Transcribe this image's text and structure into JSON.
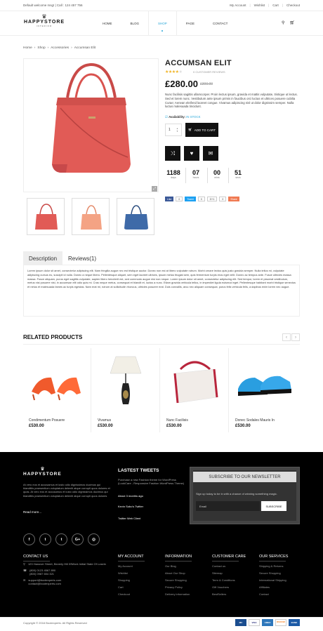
{
  "topbar": {
    "welcome": "Default welcome msg! | Call : 124 457 756",
    "links": [
      "My Account",
      "Wishlist",
      "Cart",
      "Checkout"
    ]
  },
  "logo": {
    "name": "HAPPYSTORE",
    "tag": "INTERIOR"
  },
  "nav": [
    "HOME",
    "BLOG",
    "SHOP",
    "PAGE",
    "CONTACT"
  ],
  "breadcrumb": [
    "Home",
    "Shop",
    "Accessories",
    "Accumsan Elit"
  ],
  "product": {
    "title": "ACCUMSAN ELIT",
    "reviews": "0 CUSTOMER REVIEWS",
    "rating": 4,
    "price": "£280.00",
    "old_price": "£300.00",
    "description": "Nunc facilisis sagittis ullamcorper. Proin lectus ipsum, gravida et mattis vulputate, tristique ut lectus. Sed et lorem nunc. Vestibulum ante ipsum primis in faucibus orci luctus et ultrices posuere cubilia Curae; Aenean eleifend laoreet congue. Vivamus adipiscing nisl ut dolor dignissim semper. Nulla luctus malesuada tincidunt.",
    "availability_label": "Availability:",
    "availability_value": "IN STOCK",
    "qty": "1",
    "add_to_cart": "ADD TO CART",
    "timer": [
      {
        "n": "1188",
        "l": "days"
      },
      {
        "n": "07",
        "l": "hours"
      },
      {
        "n": "00",
        "l": "mins"
      },
      {
        "n": "51",
        "l": "secs"
      }
    ],
    "share": [
      "Like",
      "0",
      "Tweet",
      "0",
      "G+1",
      "0",
      "Share"
    ]
  },
  "tabs": [
    "Description",
    "Reviews(1)"
  ],
  "tab_body": "Lorem ipsum dolor sit amet, consectetur adipiscing elit. Nam fringilla augue nec est tristique auctor. Donec non est at libero vulputate rutrum. Morbi ornare lectus quis justo gravida semper. Nulla tellus mi, vulputate adipiscing cursus eu, suscipit id nulla. Donec a neque libero. Pellentesque aliquet, sem eget laoreet ultrices, ipsum metus feugiat sem, quis fermentum turpis eros eget velit. Donec ac tempus ante. Fusce ultricies massa massa. Fusce aliquam, purus eget sagittis vulputate, sapien libero hendrerit est, sed commodo augue nisi non neque. Lorem ipsum dolor sit amet, consectetur adipiscing elit. Sed tempor, lorem et placerat vestibulum, metus nisi posuere nisl, in accumsan elit odio quis mi. Cras neque metus, consequat et blandit et, luctus a nunc. Etiam gravida vehicula tellus, in imperdiet ligula euismod eget. Pellentesque habitant morbi tristique senectus et netus et malesuada fames ac turpis egestas. Nam erat mi, rutrum at sollicitudin rhoncus, ultricies posuere erat. Duis convallis, arcu nec aliquam consequat, purus felis vehicula felis, a dapibus enim lorem nec augue.",
  "related": {
    "title": "RELATED PRODUCTS",
    "items": [
      {
        "name": "Condimentum Posuere",
        "price": "£530.00"
      },
      {
        "name": "Vivamus",
        "price": "£530.00"
      },
      {
        "name": "Nunc Facilisis",
        "price": "£530.00"
      },
      {
        "name": "Donec Sodales Mauris In",
        "price": "£530.00"
      }
    ]
  },
  "footer": {
    "logo": "HAPPYSTORE",
    "about": "At vero eos et accusamus et iusto odio dignissimos ducimus qui blanditiis praesentium voluptatum deleniti atque corrupti quos dolores et quas. At vero eos et accusamus et iusto odio dignissimos ducimus qui blanditiis praesentium voluptatum deleniti atque corrupti quos dolores",
    "read_more": "Read more...",
    "tweets_title": "LASTEST TWEETS",
    "tweets": [
      "Purchase a new Fashion theme for WordPress (LookCare - Responsive Fashion WordPress Theme)",
      "About 3 months ago",
      "Kevin Sobo's Twitter",
      "Twitter Web Client"
    ],
    "newsletter_title": "SUBSCRIBE TO OUR NEWSLETTER",
    "newsletter_desc": "Sign up today to be in with a chance of winning something magic.",
    "newsletter_placeholder": "Email",
    "newsletter_button": "SUBSCRIBE",
    "social": [
      "f",
      "t",
      "t",
      "G+",
      "◎"
    ],
    "contact_title": "CONTACT US",
    "contact": [
      "123 Hanover Street, Beverly Hill 09Work Initial State Of Losein",
      "(800) 0123 4567 890",
      "(800) 0987 654 321",
      "support@bootexperts.com",
      "contact@bootexperts.com"
    ],
    "columns": [
      {
        "title": "MY ACCOUNT",
        "items": [
          "My Account",
          "Wishlist",
          "Shopping",
          "Cart",
          "Checkout"
        ]
      },
      {
        "title": "INFORMATION",
        "items": [
          "Our Blog",
          "About Our Shop",
          "Secure Shopping",
          "Privacy Policy",
          "Delivery information"
        ]
      },
      {
        "title": "CUSTOMER CARE",
        "items": [
          "Contact us",
          "Sitemap",
          "Term & Conditions",
          "Gift Vouchers",
          "BestSellers"
        ]
      },
      {
        "title": "OUR SERVICES",
        "items": [
          "Shipping & Returns",
          "Secure Shopping",
          "International Shipping",
          "Affiliates",
          "Contact"
        ]
      }
    ],
    "copyright": "Copyright © 2016 Bootexperts. All Rights Reserved",
    "cards": [
      "MC",
      "VISA",
      "AMEX",
      "DISCOVER",
      "BANK"
    ]
  },
  "colors": {
    "accent": "#29a7d8",
    "star": "#f0b323",
    "dark": "#111111"
  }
}
